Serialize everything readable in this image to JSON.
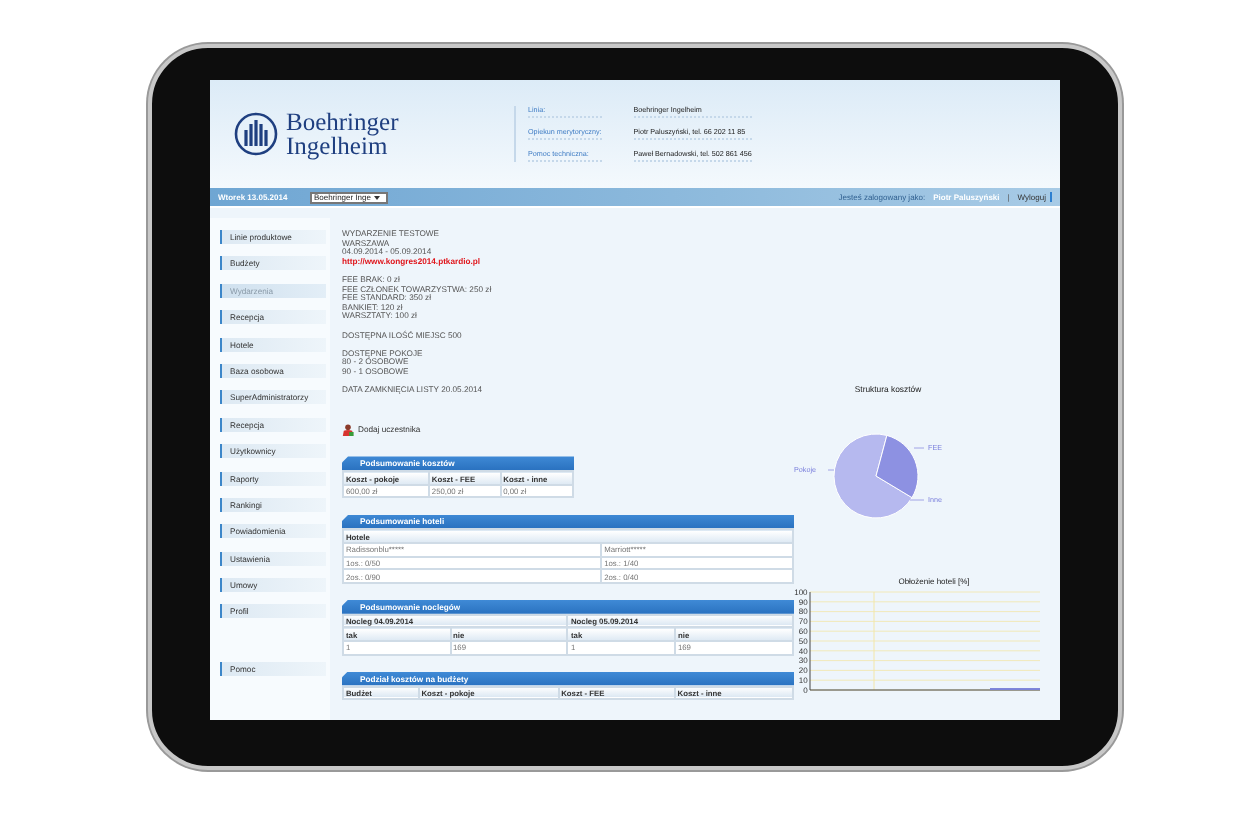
{
  "header": {
    "logo_lines": [
      "Boehringer",
      "Ingelheim"
    ],
    "info": [
      {
        "label": "Linia:",
        "value": "Boehringer Ingelheim"
      },
      {
        "label": "Opiekun merytoryczny:",
        "value": "Piotr Paluszyński, tel. 66 202 11 85"
      },
      {
        "label": "Pomoc techniczna:",
        "value": "Paweł Bernadowski, tel. 502 861 456"
      }
    ]
  },
  "nav": {
    "date": "Wtorek 13.05.2014",
    "select_value": "Boehringer Inge",
    "logged_label": "Jesteś zalogowany jako:",
    "user": "Piotr Paluszyński",
    "separator": "|",
    "logout": "Wyloguj"
  },
  "sidebar": {
    "items": [
      {
        "label": "Linie produktowe",
        "selected": false
      },
      {
        "label": "Budżety",
        "selected": false
      },
      {
        "label": "Wydarzenia",
        "selected": true
      },
      {
        "label": "Recepcja",
        "selected": false
      },
      {
        "label": "Hotele",
        "selected": false
      },
      {
        "label": "Baza osobowa",
        "selected": false
      },
      {
        "label": "SuperAdministratorzy",
        "selected": false
      },
      {
        "label": "Recepcja",
        "selected": false
      },
      {
        "label": "Użytkownicy",
        "selected": false
      },
      {
        "label": "Raporty",
        "selected": false
      },
      {
        "label": "Rankingi",
        "selected": false
      },
      {
        "label": "Powiadomienia",
        "selected": false
      },
      {
        "label": "Ustawienia",
        "selected": false
      },
      {
        "label": "Umowy",
        "selected": false
      },
      {
        "label": "Profil",
        "selected": false
      }
    ],
    "help_item": {
      "label": "Pomoc",
      "selected": false
    }
  },
  "event": {
    "blocks": [
      {
        "lines": [
          {
            "kind": "text",
            "text": "WYDARZENIE TESTOWE"
          },
          {
            "kind": "text",
            "text": "WARSZAWA"
          },
          {
            "kind": "text",
            "text": "04.09.2014 - 05.09.2014"
          },
          {
            "kind": "link",
            "text": "http://www.kongres2014.ptkardio.pl"
          }
        ]
      },
      {
        "lines": [
          {
            "kind": "text",
            "text": "FEE BRAK: 0 zł"
          },
          {
            "kind": "text",
            "text": "FEE CZŁONEK TOWARZYSTWA: 250 zł"
          },
          {
            "kind": "text",
            "text": "FEE STANDARD: 350 zł"
          },
          {
            "kind": "text",
            "text": "BANKIET: 120 zł"
          },
          {
            "kind": "text",
            "text": "WARSZTATY: 100 zł"
          }
        ]
      },
      {
        "lines": [
          {
            "kind": "text",
            "text": "DOSTĘPNA ILOŚĆ MIEJSC 500"
          }
        ]
      },
      {
        "lines": [
          {
            "kind": "text",
            "text": "DOSTĘPNE POKOJE"
          },
          {
            "kind": "text",
            "text": "80 - 2 OSOBOWE"
          },
          {
            "kind": "text",
            "text": "90 - 1 OSOBOWE"
          }
        ]
      },
      {
        "lines": [
          {
            "kind": "text",
            "text": "DATA ZAMKNIĘCIA LISTY 20.05.2014"
          }
        ]
      }
    ],
    "add_participant": "Dodaj uczestnika"
  },
  "tables": [
    {
      "title": "Podsumowanie kosztów",
      "rows": [
        {
          "kind": "head",
          "cells": [
            "Koszt - pokoje",
            "Koszt - FEE",
            "Koszt - inne"
          ]
        },
        {
          "kind": "cell",
          "cells": [
            "600,00 zł",
            "250,00 zł",
            "0,00 zł"
          ]
        }
      ]
    },
    {
      "title": "Podsumowanie hoteli",
      "rows": [
        {
          "kind": "head",
          "cells": [
            {
              "text": "Hotele",
              "colspan": 2
            }
          ]
        },
        {
          "kind": "cell",
          "cells": [
            "Radissonblu*****",
            "Marriott*****"
          ]
        },
        {
          "kind": "cell",
          "cells": [
            "1os.: 0/50",
            "1os.: 1/40"
          ]
        },
        {
          "kind": "cell",
          "cells": [
            "2os.: 0/90",
            "2os.: 0/40"
          ]
        }
      ]
    },
    {
      "title": "Podsumowanie noclegów",
      "rows": [
        {
          "kind": "head",
          "cells": [
            {
              "text": "Nocleg 04.09.2014",
              "colspan": 2
            },
            {
              "text": "Nocleg 05.09.2014",
              "colspan": 2
            }
          ]
        },
        {
          "kind": "head",
          "cells": [
            "tak",
            "nie",
            "tak",
            "nie"
          ]
        },
        {
          "kind": "cell",
          "cells": [
            "1",
            "169",
            "1",
            "169"
          ]
        }
      ]
    },
    {
      "title": "Podział kosztów na budżety",
      "rows": [
        {
          "kind": "head",
          "cells": [
            "Budżet",
            "Koszt - pokoje",
            "Koszt - FEE",
            "Koszt - inne"
          ]
        }
      ]
    }
  ],
  "cost_chart": {
    "title": "Struktura kosztów",
    "labels": [
      "Pokoje",
      "FEE",
      "Inne"
    ]
  },
  "occupancy_chart": {
    "chart_data": {
      "type": "bar",
      "title": "Obłożenie hoteli [%]",
      "values": [
        2
      ],
      "grid": true,
      "ylim": [
        0,
        100
      ],
      "yticks": [
        0,
        10,
        20,
        30,
        40,
        50,
        60,
        70,
        80,
        90,
        100
      ]
    }
  }
}
